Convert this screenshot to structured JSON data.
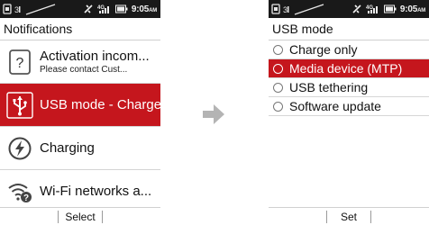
{
  "status_bar": {
    "time": "9:05",
    "ampm": "AM",
    "network": "4G"
  },
  "left_screen": {
    "title": "Notifications",
    "notifications": [
      {
        "icon": "question-icon",
        "title": "Activation incom...",
        "subtitle": "Please contact Cust..."
      },
      {
        "icon": "usb-icon",
        "title": "USB mode - Charge",
        "subtitle": ""
      },
      {
        "icon": "charging-icon",
        "title": "Charging",
        "subtitle": ""
      },
      {
        "icon": "wifi-question-icon",
        "title": "Wi-Fi networks a...",
        "subtitle": ""
      }
    ],
    "softkeys": {
      "left": "",
      "center": "Select",
      "right": ""
    }
  },
  "right_screen": {
    "title": "USB mode",
    "options": [
      {
        "label": "Charge only",
        "selected": false
      },
      {
        "label": "Media device (MTP)",
        "selected": true
      },
      {
        "label": "USB tethering",
        "selected": false
      },
      {
        "label": "Software update",
        "selected": false
      }
    ],
    "softkeys": {
      "left": "",
      "center": "Set",
      "right": ""
    }
  },
  "colors": {
    "accent": "#c5161d",
    "status_bar": "#191919",
    "arrow": "#b4b4b4"
  }
}
